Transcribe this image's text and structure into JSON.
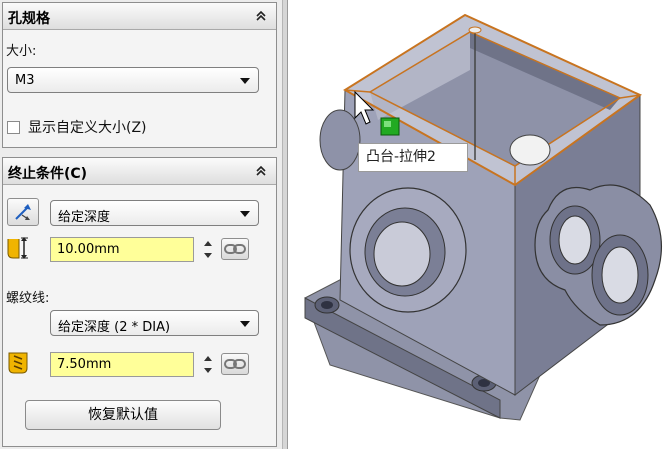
{
  "hole_spec": {
    "title": "孔规格",
    "size_label": "大小:",
    "size_value": "M3",
    "custom_size_label": "显示自定义大小(Z)",
    "custom_size_checked": false
  },
  "end_condition": {
    "title": "终止条件(C)",
    "type_value": "给定深度",
    "depth_value": "10.00mm",
    "thread_label": "螺纹线:",
    "thread_type_value": "给定深度 (2 * DIA)",
    "thread_depth_value": "7.50mm",
    "restore_defaults_label": "恢复默认值"
  },
  "viewport": {
    "tooltip": "凸台-拉伸2",
    "highlight_color": "#c87420",
    "model_color": "#9ea2b8",
    "handle_color": "#22aa22"
  }
}
